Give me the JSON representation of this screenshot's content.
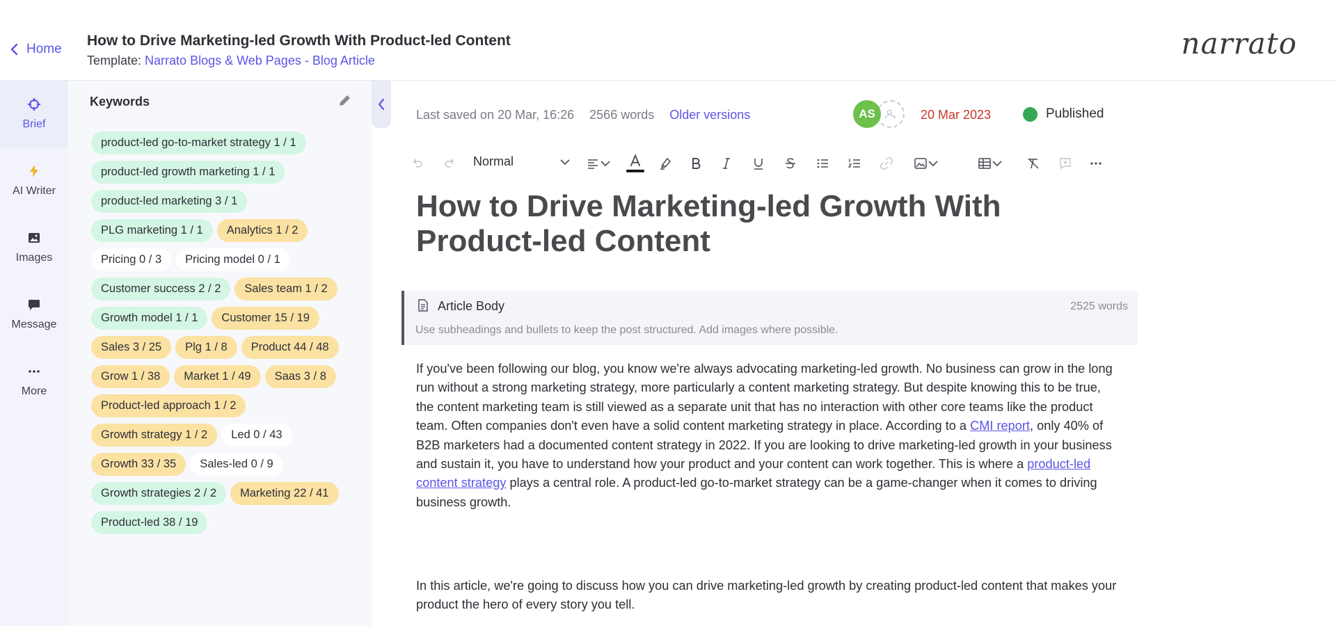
{
  "header": {
    "home_label": "Home",
    "title": "How to Drive Marketing-led Growth With Product-led Content",
    "template_prefix": "Template: ",
    "template_link": "Narrato Blogs & Web Pages - Blog Article",
    "logo_text": "narrato"
  },
  "rail": {
    "items": [
      {
        "label": "Brief",
        "icon": "target-icon"
      },
      {
        "label": "AI Writer",
        "icon": "lightning-icon"
      },
      {
        "label": "Images",
        "icon": "image-icon"
      },
      {
        "label": "Message",
        "icon": "chat-icon"
      },
      {
        "label": "More",
        "icon": "more-icon"
      }
    ]
  },
  "keywords": {
    "heading": "Keywords",
    "items": [
      {
        "text": "product-led go-to-market strategy  1 / 1",
        "status": "green"
      },
      {
        "text": "product-led growth marketing  1 / 1",
        "status": "green"
      },
      {
        "text": "product-led marketing  3 / 1",
        "status": "green"
      },
      {
        "text": "PLG marketing  1 / 1",
        "status": "green"
      },
      {
        "text": "Analytics  1 / 2",
        "status": "yellow"
      },
      {
        "text": "Pricing  0 / 3",
        "status": "white"
      },
      {
        "text": "Pricing model  0 / 1",
        "status": "white"
      },
      {
        "text": "Customer success  2 / 2",
        "status": "green"
      },
      {
        "text": "Sales team  1 / 2",
        "status": "yellow"
      },
      {
        "text": "Growth model  1 / 1",
        "status": "green"
      },
      {
        "text": "Customer  15 / 19",
        "status": "yellow"
      },
      {
        "text": "Sales  3 / 25",
        "status": "yellow"
      },
      {
        "text": "Plg  1 / 8",
        "status": "yellow"
      },
      {
        "text": "Product  44 / 48",
        "status": "yellow"
      },
      {
        "text": "Grow  1 / 38",
        "status": "yellow"
      },
      {
        "text": "Market  1 / 49",
        "status": "yellow"
      },
      {
        "text": "Saas  3 / 8",
        "status": "yellow"
      },
      {
        "text": "Product-led approach  1 / 2",
        "status": "yellow"
      },
      {
        "text": "Growth strategy  1 / 2",
        "status": "yellow"
      },
      {
        "text": "Led  0 / 43",
        "status": "white"
      },
      {
        "text": "Growth  33 / 35",
        "status": "yellow"
      },
      {
        "text": "Sales-led  0 / 9",
        "status": "white"
      },
      {
        "text": "Growth strategies  2 / 2",
        "status": "green"
      },
      {
        "text": "Marketing  22 / 41",
        "status": "yellow"
      },
      {
        "text": "Product-led  38 / 19",
        "status": "green"
      }
    ]
  },
  "meta": {
    "last_saved": "Last saved on 20 Mar, 16:26",
    "word_count": "2566 words",
    "older_versions": "Older versions",
    "avatar_initials": "AS",
    "due_date": "20 Mar 2023",
    "status": "Published"
  },
  "toolbar": {
    "style_value": "Normal"
  },
  "article": {
    "title": "How to Drive Marketing-led Growth With Product-led Content",
    "section_label": "Article Body",
    "section_words": "2525 words",
    "section_hint": "Use subheadings and bullets to keep the post structured. Add images where possible.",
    "p1_a": "If you've been following our blog, you know we're always advocating marketing-led growth. No business can grow in the long run without a strong marketing strategy, more particularly a content marketing strategy. But despite knowing this to be true, the content marketing team is still viewed as a separate unit that has no interaction with other core teams like the product team. Often companies don't even have a solid content marketing strategy in place. According to a ",
    "p1_link1": "CMI report",
    "p1_b": ", only 40% of B2B marketers had a documented content strategy in 2022. If you are looking to drive marketing-led growth in your business and sustain it, you have to understand how your product and your content can work together. This is where a ",
    "p1_link2": "product-led content strategy",
    "p1_c": " plays a central role. A product-led go-to-market strategy can be a game-changer when it comes to driving business growth.",
    "p2": "In this article, we're going to discuss how you can drive marketing-led growth by creating product-led content that makes your product the hero of every story you tell."
  },
  "colors": {
    "accent": "#5b55e6",
    "chip_green": "#d4f6e4",
    "chip_yellow": "#fbe2a2",
    "due_date": "#c8372b",
    "published": "#34a853",
    "avatar": "#6dc04b"
  }
}
